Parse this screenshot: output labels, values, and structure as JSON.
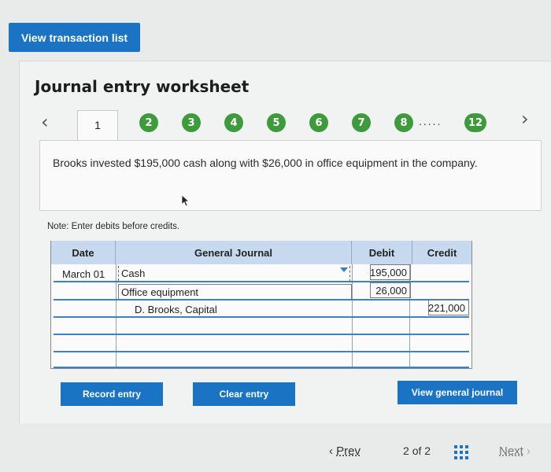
{
  "top_button": "View transaction list",
  "worksheet": {
    "title": "Journal entry worksheet",
    "active_tab": "1",
    "steps": [
      "2",
      "3",
      "4",
      "5",
      "6",
      "7",
      "8"
    ],
    "ellipsis": ".....",
    "last_step": "12"
  },
  "description": "Brooks invested $195,000 cash along with $26,000 in office equipment in the company.",
  "note": "Note: Enter debits before credits.",
  "table": {
    "headers": {
      "date": "Date",
      "journal": "General Journal",
      "debit": "Debit",
      "credit": "Credit"
    },
    "rows": [
      {
        "date": "March 01",
        "account": "Cash",
        "debit": "195,000",
        "credit": ""
      },
      {
        "date": "",
        "account": "Office equipment",
        "debit": "26,000",
        "credit": ""
      },
      {
        "date": "",
        "account": "D. Brooks, Capital",
        "debit": "",
        "credit": "221,000"
      },
      {
        "date": "",
        "account": "",
        "debit": "",
        "credit": ""
      },
      {
        "date": "",
        "account": "",
        "debit": "",
        "credit": ""
      },
      {
        "date": "",
        "account": "",
        "debit": "",
        "credit": ""
      }
    ]
  },
  "buttons": {
    "record": "Record entry",
    "clear": "Clear entry",
    "view_journal": "View general journal"
  },
  "footer": {
    "prev": "Prev",
    "page_current": "2",
    "page_of": "of",
    "page_total": "2",
    "next": "Next"
  },
  "icons": {
    "prev_chevron": "chevron-left-icon",
    "next_chevron": "chevron-right-icon",
    "grid": "grid-icon",
    "cursor": "cursor-icon"
  },
  "colors": {
    "primary_button": "#1a74c3",
    "step_green": "#3e9a3c",
    "table_header": "#c6d9ef",
    "row_line": "#3b83c8"
  }
}
